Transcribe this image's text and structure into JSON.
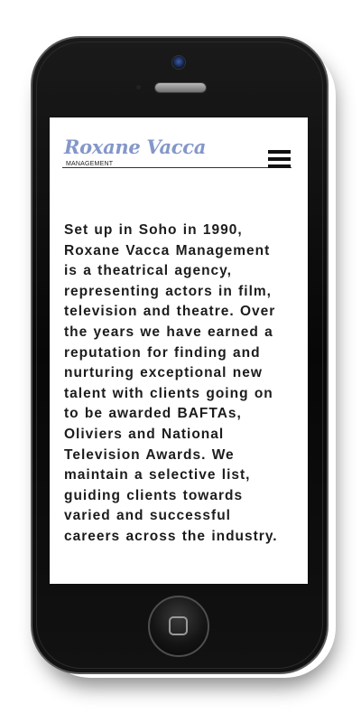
{
  "brand": {
    "name": "Roxane Vacca",
    "tagline": "MANAGEMENT",
    "color": "#8497c9"
  },
  "nav": {
    "menu_icon": "hamburger-menu-icon"
  },
  "content": {
    "intro": "Set up in Soho in 1990,\nRoxane Vacca Management\nis a theatrical agency,\nrepresenting actors in film,\ntelevision and theatre. Over\nthe years we have earned a\nreputation for finding and\nnurturing exceptional new\ntalent with clients going on\nto be awarded BAFTAs,\nOliviers and National\nTelevision Awards. We\nmaintain a selective list,\nguiding clients towards\nvaried and successful\ncareers across the industry.",
    "text_color": "#1c1c1c"
  },
  "device": {
    "home_icon": "home-square-icon",
    "camera_icon": "front-camera-icon"
  }
}
